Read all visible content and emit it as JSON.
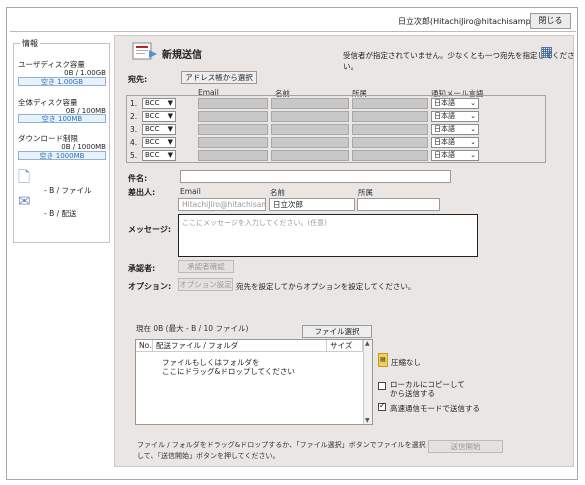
{
  "header": {
    "user": "日立次郎(HitachiJiro@hitachisample.com)",
    "close_label": "閉じる"
  },
  "info": {
    "legend": "情報",
    "user_disk_label": "ユーザディスク容量",
    "user_disk_value": "0B / 1.00GB",
    "user_disk_free": "空き 1.00GB",
    "all_disk_label": "全体ディスク容量",
    "all_disk_value": "0B / 100MB",
    "all_disk_free": "空き 100MB",
    "download_label": "ダウンロード制限",
    "download_value": "0B / 1000MB",
    "download_free": "空き 1000MB",
    "file_text": "- B / ファイル",
    "delivery_text": "- B / 配送"
  },
  "main": {
    "title": "新規送信",
    "warning": "受信者が指定されていません。少なくとも一つ宛先を指定してください。",
    "dest_label": "宛先:",
    "address_book_btn": "アドレス帳から選択",
    "col_email": "Email",
    "col_name": "名前",
    "col_affiliation": "所属",
    "col_notify_lang": "通知メール言語",
    "rows": [
      {
        "num": "1.",
        "type": "BCC",
        "lang": "日本語"
      },
      {
        "num": "2.",
        "type": "BCC",
        "lang": "日本語"
      },
      {
        "num": "3.",
        "type": "BCC",
        "lang": "日本語"
      },
      {
        "num": "4.",
        "type": "BCC",
        "lang": "日本語"
      },
      {
        "num": "5.",
        "type": "BCC",
        "lang": "日本語"
      }
    ],
    "subject_label": "件名:",
    "subject_value": "",
    "sender_label": "差出人:",
    "sender_email_label": "Email",
    "sender_name_label": "名前",
    "sender_aff_label": "所属",
    "sender_email": "HitachiJiro@hitachisample.c",
    "sender_name": "日立次郎",
    "sender_aff": "",
    "message_label": "メッセージ:",
    "message_placeholder": "ここにメッセージを入力してください。(任意)",
    "approver_label": "承認者:",
    "approver_btn": "承認者確認",
    "option_label": "オプション:",
    "option_btn": "オプション設定",
    "option_note": "宛先を設定してからオプションを設定してください。",
    "size_status": "現在 0B (最大 - B / 10 ファイル)",
    "file_select_btn": "ファイル選択",
    "file_col_no": "No.",
    "file_col_name": "配送ファイル / フォルダ",
    "file_col_size": "サイズ",
    "drop_hint_1": "ファイルもしくはフォルダを",
    "drop_hint_2": "ここにドラッグ&ドロップしてください",
    "compress_label": "圧縮なし",
    "local_copy_label": "ローカルにコピーしてから送信する",
    "fast_mode_label": "高速通信モードで送信する",
    "fast_mode_checked": true,
    "footer_note": "ファイル / フォルダをドラッグ&ドロップするか、「ファイル選択」ボタンでファイルを選択して、「送信開始」ボタンを押してください。",
    "send_btn": "送信開始"
  },
  "colors": {
    "panel_bg": "#eae6e4",
    "meter_text": "#2a6fbd",
    "disabled_field": "#c8c8c8"
  }
}
